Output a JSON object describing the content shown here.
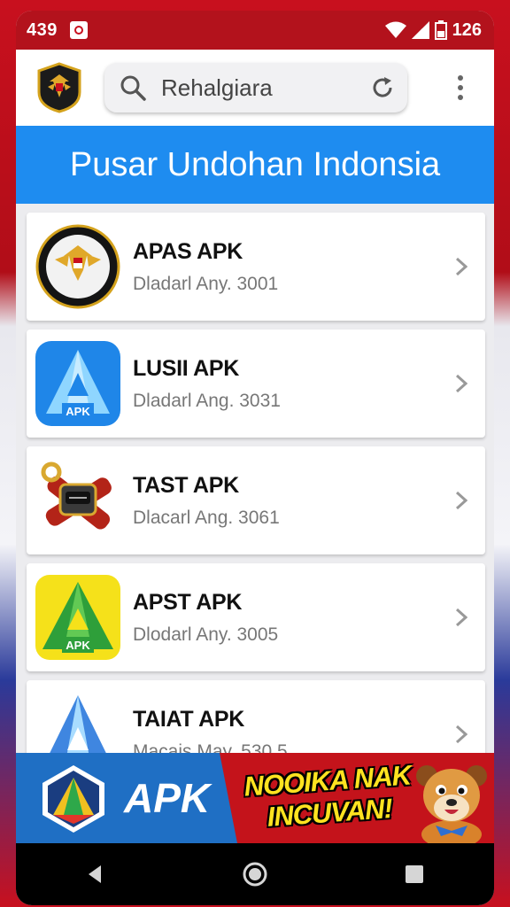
{
  "status_bar": {
    "time": "439",
    "battery": "126",
    "icons": [
      "wifi-icon",
      "signal-icon",
      "battery-icon",
      "notification-icon"
    ]
  },
  "app_bar": {
    "logo": "garuda-emblem-logo",
    "search": {
      "value": "Rehalgiara",
      "icons": [
        "search-icon",
        "refresh-icon"
      ]
    },
    "menu_icon": "more-vert-icon"
  },
  "header": {
    "title": "Pusar Undohan Indonsia"
  },
  "apps": [
    {
      "name": "APAS APK",
      "meta": "Dladarl Any. 3001",
      "icon": "garuda-badge-icon"
    },
    {
      "name": "LUSII APK",
      "meta": "Dladarl Ang. 3031",
      "icon": "blue-a-apk-icon"
    },
    {
      "name": "TAST APK",
      "meta": "Dlacarl Ang. 3061",
      "icon": "usb-tool-icon"
    },
    {
      "name": "APST APK",
      "meta": "Dlodarl Any. 3005",
      "icon": "green-a-apk-icon"
    },
    {
      "name": "TAIAT APK",
      "meta": "Macais May. 530 5",
      "icon": "crystal-a-icon"
    }
  ],
  "banner": {
    "apk_label": "APK",
    "slogan_line1": "NOOIKA NAK",
    "slogan_line2": "INCUVAN!",
    "mascot": "dog-mascot"
  },
  "nav_bar": {
    "buttons": [
      "back-icon",
      "home-icon",
      "recents-icon"
    ]
  },
  "colors": {
    "status_bar": "#b3121c",
    "title_bar": "#1e8cf0",
    "banner_red": "#c4131b",
    "banner_blue": "#1f6fc4",
    "slogan": "#ffe320"
  }
}
